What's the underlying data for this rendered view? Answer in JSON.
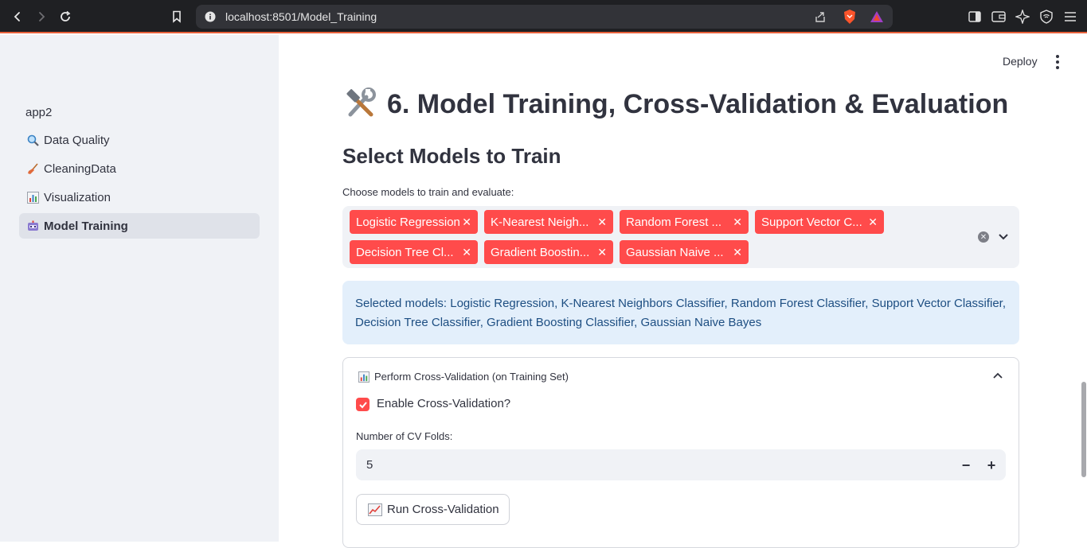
{
  "browser": {
    "url": "localhost:8501/Model_Training"
  },
  "sidebar": {
    "title": "app2",
    "items": [
      {
        "label": "Data Quality",
        "icon": "magnifier-icon"
      },
      {
        "label": "CleaningData",
        "icon": "broom-icon"
      },
      {
        "label": "Visualization",
        "icon": "bar-chart-icon"
      },
      {
        "label": "Model Training",
        "icon": "robot-icon",
        "active": true
      }
    ]
  },
  "header": {
    "deploy_label": "Deploy"
  },
  "main": {
    "title": "6. Model Training, Cross-Validation & Evaluation",
    "subtitle": "Select Models to Train",
    "multiselect": {
      "label": "Choose models to train and evaluate:",
      "tags": [
        "Logistic Regression",
        "K-Nearest Neigh...",
        "Random Forest ...",
        "Support Vector C...",
        "Decision Tree Cl...",
        "Gradient Boostin...",
        "Gaussian Naive ..."
      ]
    },
    "info_text": "Selected models: Logistic Regression, K-Nearest Neighbors Classifier, Random Forest Classifier, Support Vector Classifier, Decision Tree Classifier, Gradient Boosting Classifier, Gaussian Naive Bayes",
    "expander": {
      "title": "Perform Cross-Validation (on Training Set)",
      "checkbox_label": "Enable Cross-Validation?",
      "checkbox_checked": true,
      "folds_label": "Number of CV Folds:",
      "folds_value": "5",
      "run_button_label": "Run Cross-Validation"
    }
  },
  "colors": {
    "accent": "#ff4b4b",
    "sidebar_bg": "#f0f2f6",
    "info_bg": "#e3effb",
    "info_text": "#1d4e82"
  }
}
